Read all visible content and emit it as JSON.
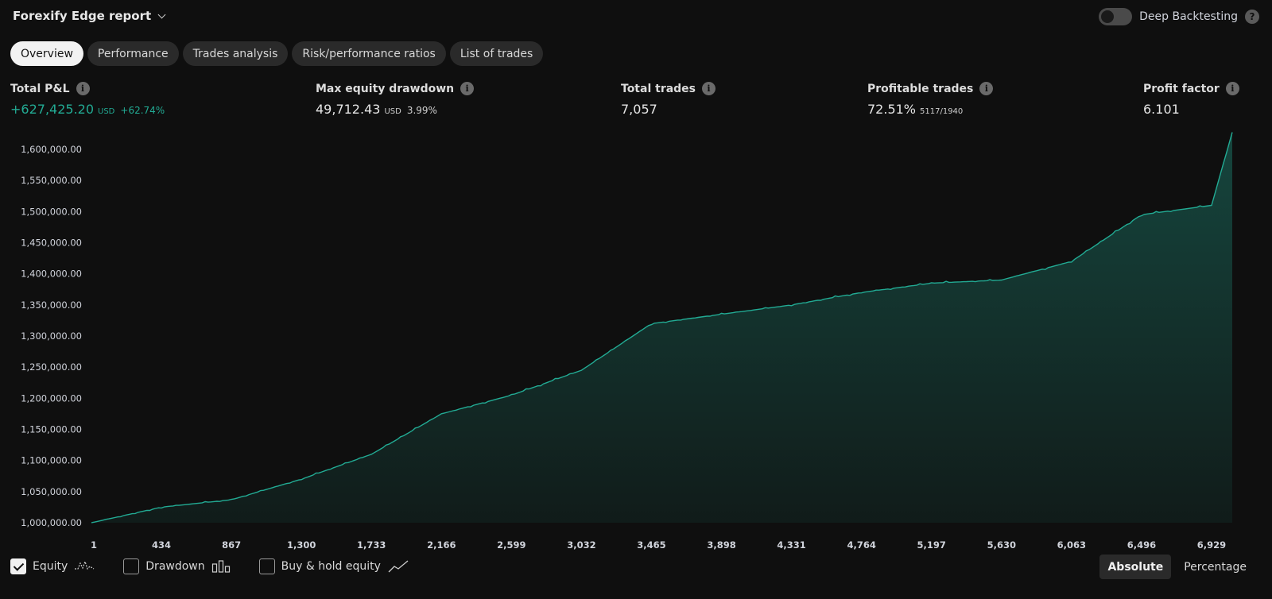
{
  "header": {
    "title": "Forexify Edge report",
    "deep_backtesting_label": "Deep Backtesting",
    "deep_backtesting_enabled": false
  },
  "tabs": [
    {
      "label": "Overview",
      "active": true
    },
    {
      "label": "Performance",
      "active": false
    },
    {
      "label": "Trades analysis",
      "active": false
    },
    {
      "label": "Risk/performance ratios",
      "active": false
    },
    {
      "label": "List of trades",
      "active": false
    }
  ],
  "metrics": {
    "total_pnl": {
      "label": "Total P&L",
      "value": "+627,425.20",
      "unit": "USD",
      "pct": "+62.74%"
    },
    "max_drawdown": {
      "label": "Max equity drawdown",
      "value": "49,712.43",
      "unit": "USD",
      "pct": "3.99%"
    },
    "total_trades": {
      "label": "Total trades",
      "value": "7,057"
    },
    "profitable_trades": {
      "label": "Profitable trades",
      "value": "72.51%",
      "ratio": "5117/1940"
    },
    "profit_factor": {
      "label": "Profit factor",
      "value": "6.101"
    }
  },
  "colors": {
    "accent": "#22ab94",
    "background": "#0f0f0f"
  },
  "chart_data": {
    "type": "area",
    "series": [
      {
        "name": "Equity",
        "x": [
          1,
          434,
          867,
          1300,
          1733,
          2166,
          2599,
          3032,
          3465,
          3898,
          4331,
          4764,
          5197,
          5630,
          6063,
          6496,
          6929,
          7057
        ],
        "values": [
          1000000,
          1025000,
          1037000,
          1070000,
          1110000,
          1175000,
          1205000,
          1245000,
          1320000,
          1335000,
          1350000,
          1370000,
          1385000,
          1390000,
          1420000,
          1495000,
          1510000,
          1627425
        ]
      }
    ],
    "y_ticks": [
      "1,000,000.00",
      "1,050,000.00",
      "1,100,000.00",
      "1,150,000.00",
      "1,200,000.00",
      "1,250,000.00",
      "1,300,000.00",
      "1,350,000.00",
      "1,400,000.00",
      "1,450,000.00",
      "1,500,000.00",
      "1,550,000.00",
      "1,600,000.00"
    ],
    "x_ticks": [
      "1",
      "434",
      "867",
      "1,300",
      "1,733",
      "2,166",
      "2,599",
      "3,032",
      "3,465",
      "3,898",
      "4,331",
      "4,764",
      "5,197",
      "5,630",
      "6,063",
      "6,496",
      "6,929"
    ],
    "ylim": [
      1000000,
      1627425
    ],
    "xlim": [
      1,
      7057
    ],
    "grid": false
  },
  "legend": [
    {
      "label": "Equity",
      "checked": true,
      "icon": "equity-line-icon"
    },
    {
      "label": "Drawdown",
      "checked": false,
      "icon": "drawdown-bars-icon"
    },
    {
      "label": "Buy & hold equity",
      "checked": false,
      "icon": "buyhold-line-icon"
    }
  ],
  "modes": [
    {
      "label": "Absolute",
      "active": true
    },
    {
      "label": "Percentage",
      "active": false
    }
  ]
}
